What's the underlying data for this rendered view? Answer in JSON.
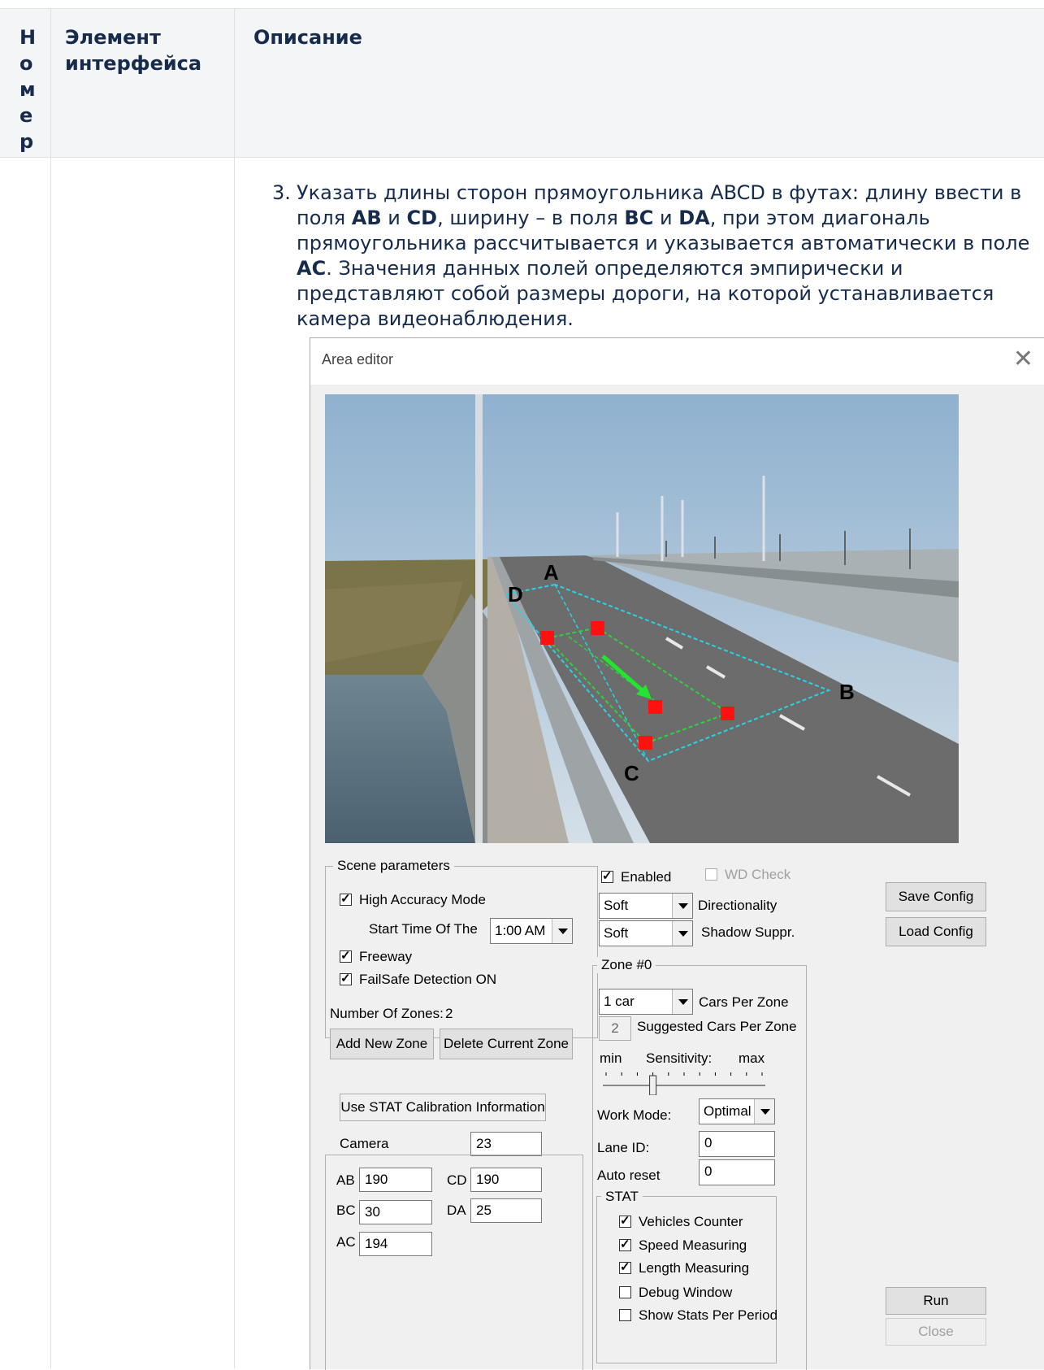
{
  "table": {
    "header": {
      "number_letters": [
        "Н",
        "о",
        "м",
        "е",
        "р"
      ],
      "element_line1": "Элемент",
      "element_line2": "интерфейса",
      "description": "Описание"
    },
    "row": {
      "step_number": "3.",
      "text": [
        {
          "t": "Указать длины сторон прямоугольника ABCD в футах: длину ввести в поля "
        },
        {
          "b": "AB"
        },
        {
          "t": " и "
        },
        {
          "b": "CD"
        },
        {
          "t": ", ширину – в поля "
        },
        {
          "b": "BC"
        },
        {
          "t": " и "
        },
        {
          "b": "DA"
        },
        {
          "t": ", при этом диагональ прямоугольника рассчитывается и указывается автоматически в поле "
        },
        {
          "b": "AC"
        },
        {
          "t": ". Значения данных полей определяются эмпирически и представляют собой размеры дороги, на которой устанавливается камера видеонаблюдения."
        }
      ]
    }
  },
  "dialog": {
    "title": "Area editor",
    "close_glyph": "✕",
    "video_labels": {
      "a": "A",
      "b": "B",
      "c": "C",
      "d": "D"
    },
    "scene": {
      "legend": "Scene parameters",
      "high_accuracy": {
        "label": "High Accuracy Mode",
        "checked": true
      },
      "start_time_label": "Start Time Of The",
      "start_time_value": "1:00 AM",
      "freeway": {
        "label": "Freeway",
        "checked": true
      },
      "failsafe": {
        "label": "FailSafe Detection ON",
        "checked": true
      },
      "zones_label": "Number Of Zones:",
      "zones_value": "2",
      "add_zone": "Add New Zone",
      "delete_zone": "Delete Current Zone"
    },
    "stat_calib": {
      "button": "Use STAT Calibration Information",
      "camera_label": "Camera",
      "camera_value": "23",
      "ab_label": "AB",
      "ab_value": "190",
      "cd_label": "CD",
      "cd_value": "190",
      "bc_label": "BC",
      "bc_value": "30",
      "da_label": "DA",
      "da_value": "25",
      "ac_label": "AC",
      "ac_value": "194"
    },
    "middle": {
      "enabled": {
        "label": "Enabled",
        "checked": true
      },
      "wd_check": {
        "label": "WD Check",
        "checked": false
      },
      "directionality_value": "Soft",
      "directionality_label": "Directionality",
      "shadow_value": "Soft",
      "shadow_label": "Shadow Suppr."
    },
    "zone": {
      "legend": "Zone #0",
      "cars_value": "1 car",
      "cars_label": "Cars Per Zone",
      "suggested_value": "2",
      "suggested_label": "Suggested Cars Per Zone",
      "sens_min": "min",
      "sens_label": "Sensitivity:",
      "sens_max": "max",
      "sensitivity_fraction": 0.3,
      "work_mode_label": "Work Mode:",
      "work_mode_value": "Optimal",
      "lane_label": "Lane ID:",
      "lane_value": "0",
      "auto_reset_label": "Auto reset",
      "auto_reset_value": "0"
    },
    "stat": {
      "legend": "STAT",
      "vehicles": {
        "label": "Vehicles Counter",
        "checked": true
      },
      "speed": {
        "label": "Speed Measuring",
        "checked": true
      },
      "length": {
        "label": "Length Measuring",
        "checked": true
      },
      "debug": {
        "label": "Debug Window",
        "checked": false
      },
      "per_period": {
        "label": "Show Stats Per Period",
        "checked": false
      }
    },
    "buttons": {
      "save": "Save Config",
      "load": "Load Config",
      "run": "Run",
      "close": "Close"
    }
  }
}
